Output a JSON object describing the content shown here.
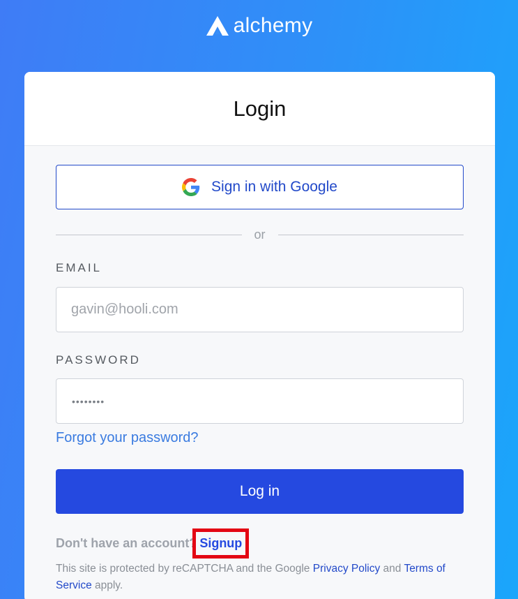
{
  "brand": {
    "name": "alchemy",
    "icon": "alchemy-logo-icon"
  },
  "card": {
    "title": "Login",
    "google_button": {
      "label": "Sign in with Google",
      "icon": "google-icon"
    },
    "divider_text": "or",
    "email": {
      "label": "EMAIL",
      "placeholder": "gavin@hooli.com",
      "value": ""
    },
    "password": {
      "label": "PASSWORD",
      "value_masked": "••••••••"
    },
    "forgot_link": "Forgot your password?",
    "login_button": "Log in",
    "signup": {
      "prompt": "Don't have an account?",
      "link": "Signup",
      "highlighted": true
    },
    "legal": {
      "prefix": "This site is protected by reCAPTCHA and the Google",
      "privacy_link": "Privacy Policy",
      "and": "and",
      "terms_link": "Terms of Service",
      "suffix": "apply."
    }
  },
  "colors": {
    "background_start": "#3f7cf6",
    "background_end": "#1aa6fb",
    "primary": "#2549e0",
    "link": "#3a7be0",
    "highlight": "#e30613"
  }
}
